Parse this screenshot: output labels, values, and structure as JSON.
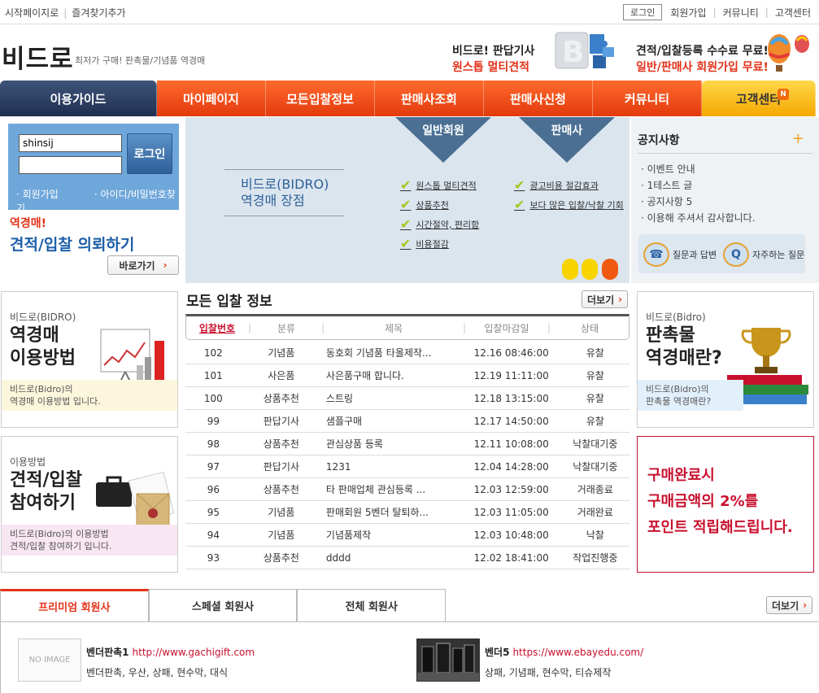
{
  "topbar": {
    "start_page": "시작페이지로",
    "bookmark": "즐겨찾기추가",
    "login_btn": "로그인",
    "join": "회원가입",
    "community": "커뮤니티",
    "cs": "고객센터"
  },
  "header": {
    "logo": "비드로",
    "slogan": "최저가 구매! 판촉물/기념품 역경매",
    "ad1_line1": "비드로! 판답기사",
    "ad1_line2": "원스톱 멀티견적",
    "ad2_line1": "견적/입찰등록 수수료 무료!",
    "ad2_line2": "일반/판매사 회원가입 무료!"
  },
  "nav": [
    "이용가이드",
    "마이페이지",
    "모든입찰정보",
    "판매사조회",
    "판매사신청",
    "커뮤니티",
    "고객센터"
  ],
  "nav_badge": "N",
  "login": {
    "id_value": "shinsij",
    "pw_value": "",
    "button": "로그인",
    "join_link": "회원가입",
    "find_link": "아이디/비밀번호찾기"
  },
  "request": {
    "small": "역경매!",
    "big": "견적/입찰 의뢰하기",
    "button": "바로가기"
  },
  "banner": {
    "title_line1": "비드로(BIDRO)",
    "title_line2": "역경매 장점",
    "flag1": "일반회원",
    "flag2": "판매사",
    "list1": [
      "원스톱 멀티견적",
      "상품추천",
      "시간절약, 편리함",
      "비용절감"
    ],
    "list2": [
      "광고비용 절감효과",
      "보다 많은 입찰/낙찰 기회"
    ]
  },
  "notice": {
    "title": "공지사항",
    "items": [
      "이벤트 안내",
      "1테스트 글",
      "공지사항 5",
      "이용해 주셔서 감사합니다."
    ],
    "qa": "질문과 답변",
    "faq": "자주하는 질문"
  },
  "left_box1": {
    "small": "비드로(BIDRO)",
    "big1": "역경매",
    "big2": "이용방법",
    "cap1": "비드로(Bidro)의",
    "cap2": "역경매 이용방법 입니다."
  },
  "left_box2": {
    "small": "이용방법",
    "big1": "견적/입찰",
    "big2": "참여하기",
    "cap1": "비드로(Bidro)의 이용방법",
    "cap2": "견적/입찰 참여하기 입니다."
  },
  "right_box1": {
    "small": "비드로(Bidro)",
    "big1": "판촉물",
    "big2": "역경매란?",
    "cap1": "비드로(Bidro)의",
    "cap2": "판촉물 역경매란?"
  },
  "point": {
    "l1": "구매완료시",
    "l2": "구매금액의 2%를",
    "l3": "포인트 적립해드립니다."
  },
  "bids": {
    "title": "모든 입찰 정보",
    "more": "더보기",
    "headers": [
      "입찰번호",
      "분류",
      "제목",
      "입찰마감일",
      "상태"
    ],
    "rows": [
      [
        "102",
        "기념품",
        "동호회 기념품 타올제작...",
        "12.16 08:46:00",
        "유찰"
      ],
      [
        "101",
        "사은품",
        "사은품구매 합니다.",
        "12.19 11:11:00",
        "유찰"
      ],
      [
        "100",
        "상품추천",
        "스트링",
        "12.18 13:15:00",
        "유찰"
      ],
      [
        "99",
        "판답기사",
        "샘플구매",
        "12.17 14:50:00",
        "유찰"
      ],
      [
        "98",
        "상품추천",
        "관심상품 등록",
        "12.11 10:08:00",
        "낙찰대기중"
      ],
      [
        "97",
        "판답기사",
        "1231",
        "12.04 14:28:00",
        "낙찰대기중"
      ],
      [
        "96",
        "상품추천",
        "타 판매업체 관심등록 ...",
        "12.03 12:59:00",
        "거래종료"
      ],
      [
        "95",
        "기념품",
        "판매회원 5벤더 탈퇴하...",
        "12.03 11:05:00",
        "거래완료"
      ],
      [
        "94",
        "기념품",
        "기념품제작",
        "12.03 10:48:00",
        "낙찰"
      ],
      [
        "93",
        "상품추천",
        "dddd",
        "12.02 18:41:00",
        "작업진행중"
      ]
    ]
  },
  "members": {
    "tabs": [
      "프리미엄 회원사",
      "스페셜 회원사",
      "전체 회원사"
    ],
    "more": "더보기",
    "vendors": [
      {
        "name": "벤더판촉1",
        "url": "http://www.gachigift.com",
        "desc": "벤더판촉, 우산, 상패, 현수막, 대식",
        "thumb": "NO IMAGE"
      },
      {
        "name": "벤더5",
        "url": "https://www.ebayedu.com/",
        "desc": "상패, 기념패, 현수막, 티슈제작",
        "thumb": ""
      }
    ]
  },
  "colors": {
    "accent": "#e3321a",
    "nav_dark": "#2a3d5e",
    "blue": "#1d5fa8",
    "red": "#c8102e"
  }
}
